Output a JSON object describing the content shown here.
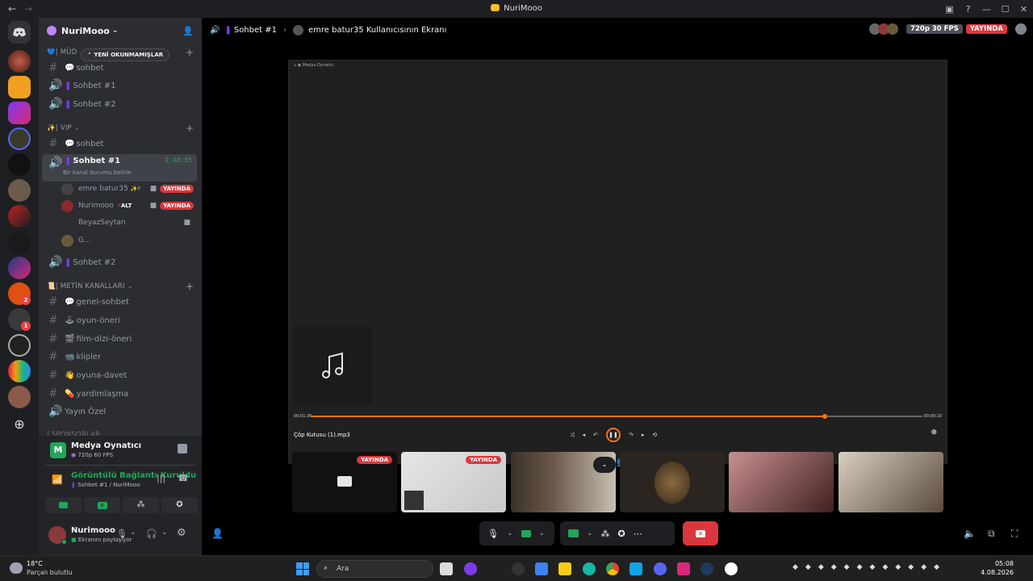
{
  "window": {
    "title": "NuriMooo"
  },
  "server": {
    "name": "NuriMooo"
  },
  "unread_pill": "YENİ OKUNMAMIŞLAR",
  "categories": {
    "mud": "| MÜD",
    "vip": "| VIP",
    "metin": "| METİN KANALLARI",
    "partial": "| SPONSORLAR"
  },
  "channels": {
    "c1": "sohbet",
    "c2": "Sohbet #1",
    "c3": "Sohbet #2",
    "c4": "sohbet",
    "c5": "Sohbet #1",
    "c6": "Sohbet #2",
    "c7": "genel-sohbet",
    "c8": "oyun-öneri",
    "c9": "film-dizi-öneri",
    "c10": "klipler",
    "c11": "oyuna-davet",
    "c12": "yardimlaşma",
    "c13": "Yayın Özel"
  },
  "active_channel": {
    "timer": "2:48:05",
    "status": "Bir kanal durumu belirle"
  },
  "voice_users": [
    {
      "name": "emre batur35",
      "live": "YAYINDA"
    },
    {
      "name": "Nurimooo",
      "tag": "ALT",
      "live": "YAYINDA"
    },
    {
      "name": "BeyazSeytan"
    },
    {
      "name": "G..."
    }
  ],
  "activity": {
    "title": "Medya Oynatıcı",
    "sub": "720p 60 FPS"
  },
  "connection": {
    "title": "Görüntülü Bağlantı Kuruldu",
    "sub": "Sohbet #1 / NuriMooo"
  },
  "user": {
    "name": "Nurimooo",
    "status": "Ekranını paylaşıyor"
  },
  "main_header": {
    "channel": "Sohbet #1",
    "stream_label": "emre batur35 Kullanıcısının Ekranı",
    "fps": "720p 30 FPS",
    "live": "YAYINDA"
  },
  "player": {
    "app_title": "Medya Oynatıcı",
    "file": "Çöp Kutusu (1).mp3",
    "time_left": "00:01:36",
    "time_right": "00:00:10",
    "progress": 0.84
  },
  "thumbs": [
    {
      "live": "YAYINDA"
    },
    {
      "live": "YAYINDA"
    }
  ],
  "taskbar": {
    "temp": "18°C",
    "weather": "Parçalı bulutlu",
    "search": "Ara",
    "time": "05:08",
    "date": "4.08.2026"
  },
  "colors": {
    "live": "#da373c",
    "green": "#23a559",
    "red": "#da373c",
    "accent": "#5865f2"
  }
}
